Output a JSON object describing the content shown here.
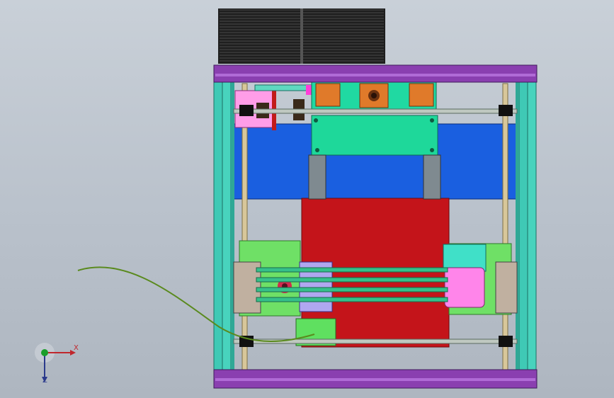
{
  "view": {
    "title": "",
    "background": "#c2c9d2"
  },
  "colors": {
    "frame_purple": "#8a3fb0",
    "frame_teal": "#3fc9b5",
    "blue_panel": "#1a5fe0",
    "green_plate": "#1ed89a",
    "red_bed": "#c4141a",
    "orange_block": "#e07a2a",
    "pink": "#ff7de6",
    "lime": "#6fe066",
    "filament": "#5a8a1e",
    "rod": "#d8c79a",
    "spool": "#2a2a2a"
  },
  "triad": {
    "x_label": "X",
    "z_label": "Z",
    "x_color": "#c0272d",
    "y_color": "#1a9e2a",
    "z_color": "#2b3a8c"
  }
}
